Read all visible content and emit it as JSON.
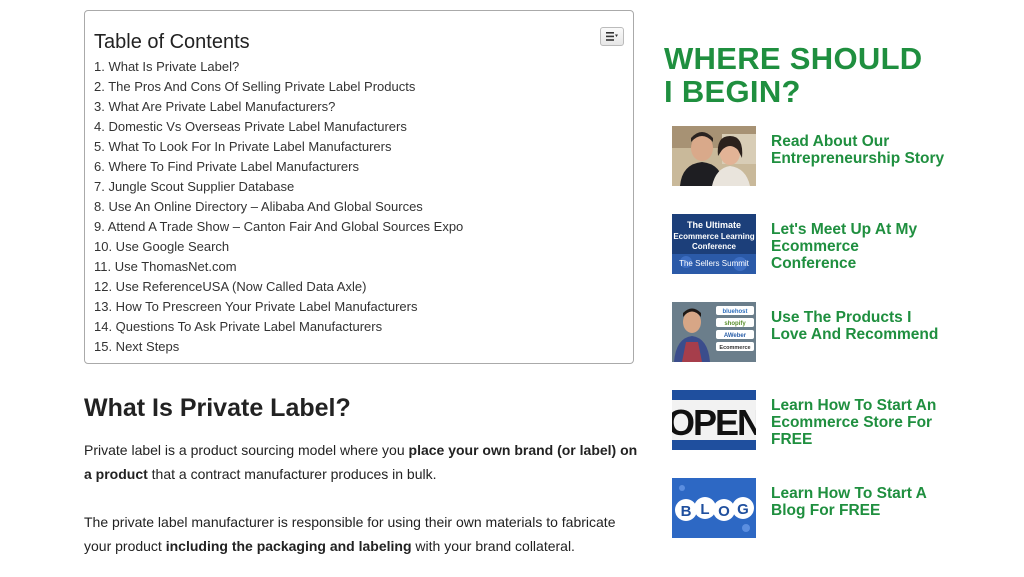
{
  "toc": {
    "title": "Table of Contents",
    "items": [
      "1. What Is Private Label?",
      "2. The Pros And Cons Of Selling Private Label Products",
      "3. What Are Private Label Manufacturers?",
      "4. Domestic Vs Overseas Private Label Manufacturers",
      "5. What To Look For In Private Label Manufacturers",
      "6. Where To Find Private Label Manufacturers",
      "7. Jungle Scout Supplier Database",
      "8. Use An Online Directory – Alibaba And Global Sources",
      "9. Attend A Trade Show – Canton Fair And Global Sources Expo",
      "10. Use Google Search",
      "11. Use ThomasNet.com",
      "12. Use ReferenceUSA (Now Called Data Axle)",
      "13. How To Prescreen Your Private Label Manufacturers",
      "14. Questions To Ask Private Label Manufacturers",
      "15. Next Steps"
    ]
  },
  "article": {
    "heading": "What Is Private Label?",
    "p1": {
      "t1": "Private label is a product sourcing model where you ",
      "b1": "place your own brand (or label) on a product",
      "t2": " that a contract manufacturer produces in bulk."
    },
    "p2": {
      "t1": "The private label manufacturer is responsible for using their own materials to fabricate your product ",
      "b1": "including the packaging and labeling",
      "t2": " with your brand collateral."
    }
  },
  "sidebar": {
    "title_line1": "WHERE SHOULD",
    "title_line2": "I BEGIN?",
    "accent": "#1f8f3f",
    "items": [
      {
        "label": "Read About Our Entrepreneurship Story"
      },
      {
        "label": "Let's Meet Up At My Ecommerce Conference",
        "thumb_lines": [
          "The Ultimate",
          "Ecommerce Learning",
          "Conference",
          "The Sellers Summit"
        ]
      },
      {
        "label": "Use The Products I Love And Recommend",
        "thumb_lines": [
          "bluehost",
          "shopify",
          "AWeber",
          "Ecommerce"
        ]
      },
      {
        "label": "Learn How To Start An Ecommerce Store For FREE",
        "thumb_lines": [
          "OPEN"
        ]
      },
      {
        "label": "Learn How To Start A Blog For FREE",
        "thumb_lines": [
          "B",
          "L",
          "O",
          "G"
        ]
      }
    ]
  }
}
